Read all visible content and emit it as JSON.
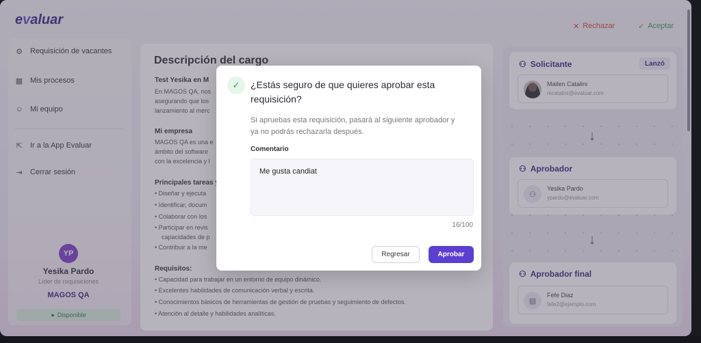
{
  "app": {
    "logo_prefix": "e",
    "logo_v": "v",
    "logo_suffix": "aluar"
  },
  "header": {
    "reject_label": "Rechazar",
    "accept_label": "Aceptar",
    "colors": {
      "reject": "#d0483f",
      "accept": "#3d9b5c"
    }
  },
  "sidebar": {
    "items": [
      {
        "label": "Requisición de vacantes",
        "icon": "gear-icon"
      },
      {
        "label": "Mis procesos",
        "icon": "grid-icon"
      },
      {
        "label": "Mi equipo",
        "icon": "team-icon"
      }
    ],
    "secondary": [
      {
        "label": "Ir a la App Evaluar",
        "icon": "external-icon"
      },
      {
        "label": "Cerrar sesión",
        "icon": "logout-icon"
      }
    ],
    "user": {
      "initials": "YP",
      "name": "Yesika Pardo",
      "role": "Líder de requisiciones",
      "company": "MAGOS QA",
      "status": "Disponible"
    }
  },
  "main": {
    "title": "Descripción del cargo",
    "job_title": "Test Yesika en M",
    "intro": [
      "En MAGOS QA, nos",
      "asegurando que los",
      "lanzamiento al merc"
    ],
    "company_heading": "Mi empresa",
    "company_text": [
      "MAGOS QA es una e",
      "ámbito del software",
      "con la excelencia y l"
    ],
    "tasks_heading": "Principales tareas y",
    "tasks": [
      "Diseñar y ejecuta",
      "Identificar, docum",
      "Colaborar con los",
      "Participar en revis",
      "capacidades de p",
      "Contribuir a la me"
    ],
    "req_heading": "Requisitos:",
    "requirements": [
      "Capacidad para trabajar en un entorno de equipo dinámico.",
      "Excelentes habilidades de comunicación verbal y escrita.",
      "Conocimientos básicos de herramientas de gestión de pruebas y seguimiento de defectos.",
      "Atención al detalle y habilidades analíticas."
    ]
  },
  "flow": {
    "requester": {
      "title": "Solicitante",
      "badge": "Lanzó",
      "name": "Mailen Catalini",
      "email": "mcatalini@evaluar.com"
    },
    "approver": {
      "title": "Aprobador",
      "name": "Yesika Pardo",
      "email": "ypardo@evaluar.com"
    },
    "final_approver": {
      "title": "Aprobador final",
      "name": "Fefe Diaz",
      "email": "fefe2@ejemplo.com"
    }
  },
  "modal": {
    "title": "¿Estás seguro de que quieres aprobar esta requisición?",
    "description": "Si apruebas esta requisición, pasará al siguiente aprobador y ya no podrás rechazarla después.",
    "comment_label": "Comentario",
    "comment_value": "Me gusta candiat",
    "char_count": "16/100",
    "back_label": "Regresar",
    "approve_label": "Aprobar",
    "accent_color": "#5b3fd0"
  }
}
